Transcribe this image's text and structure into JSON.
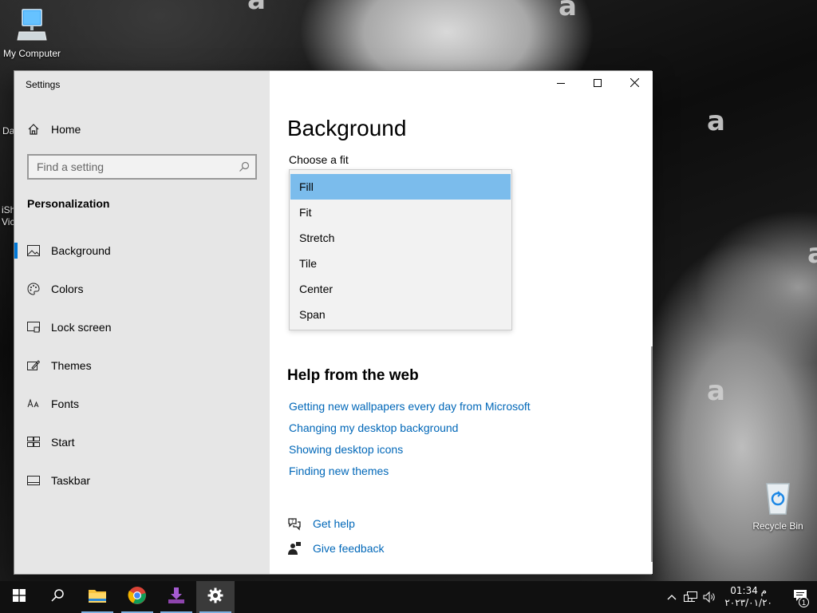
{
  "desktop": {
    "icons": [
      {
        "label": "My Computer"
      },
      {
        "label": "Recycle Bin"
      }
    ],
    "partial_labels": [
      "Da",
      "iSh",
      "Vic"
    ]
  },
  "window": {
    "title": "Settings",
    "controls": {
      "minimize": "minimize-icon",
      "maximize": "maximize-icon",
      "close": "close-icon"
    }
  },
  "nav": {
    "home": "Home",
    "search_placeholder": "Find a setting",
    "section": "Personalization",
    "items": [
      {
        "label": "Background",
        "icon": "picture-icon",
        "active": true
      },
      {
        "label": "Colors",
        "icon": "palette-icon"
      },
      {
        "label": "Lock screen",
        "icon": "lock-screen-icon"
      },
      {
        "label": "Themes",
        "icon": "themes-icon"
      },
      {
        "label": "Fonts",
        "icon": "fonts-icon"
      },
      {
        "label": "Start",
        "icon": "start-icon"
      },
      {
        "label": "Taskbar",
        "icon": "taskbar-icon"
      }
    ]
  },
  "main": {
    "title": "Background",
    "fit_label": "Choose a fit",
    "fit_options": [
      "Fill",
      "Fit",
      "Stretch",
      "Tile",
      "Center",
      "Span"
    ],
    "fit_selected": "Fill",
    "help_title": "Help from the web",
    "help_links": [
      "Getting new wallpapers every day from Microsoft",
      "Changing my desktop background",
      "Showing desktop icons",
      "Finding new themes"
    ],
    "get_help": "Get help",
    "give_feedback": "Give feedback"
  },
  "taskbar": {
    "apps": [
      "start-icon",
      "search-icon",
      "file-explorer-icon",
      "chrome-icon",
      "download-icon",
      "settings-icon"
    ],
    "clock_time": "01:34 م",
    "clock_date": "٢٠٢٣/٠١/٢٠",
    "notification_count": "1"
  },
  "colors": {
    "accent": "#0078d7",
    "link": "#0067b8",
    "selected": "#7bbcec"
  }
}
